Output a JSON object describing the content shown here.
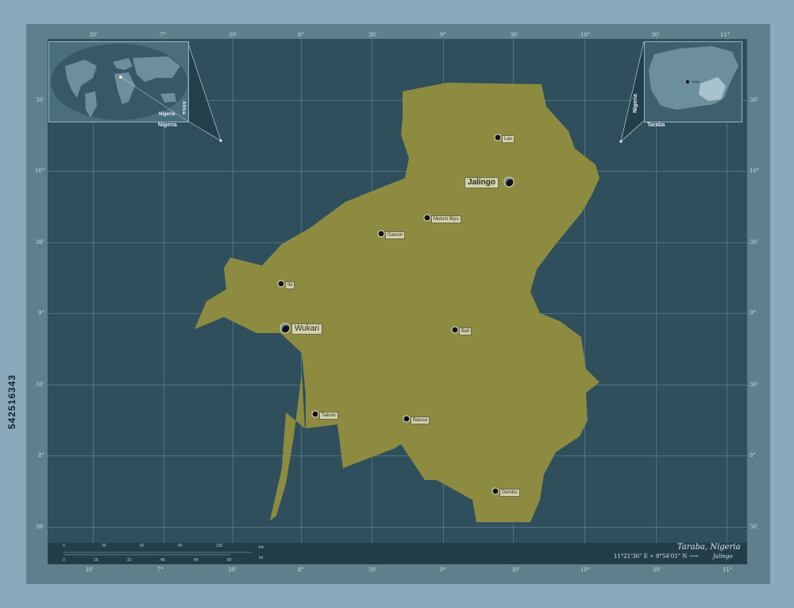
{
  "region_name": "Taraba",
  "country_name": "Nigeria",
  "continent_label": "Africa",
  "capital_inset_label": "Abuja",
  "title": "Taraba, Nigeria",
  "coordinates": "11°21'36\" E  ✧  8°54'01\" N",
  "capital_arrow": "⟶",
  "capital_name": "Jalingo",
  "watermark_id": "542516343",
  "top_ticks": [
    "30'",
    "7°",
    "30'",
    "8°",
    "30'",
    "9°",
    "30'",
    "10°",
    "30'",
    "11°"
  ],
  "bottom_ticks": [
    "30'",
    "7°",
    "30'",
    "8°",
    "30'",
    "9°",
    "30'",
    "10°",
    "30'",
    "11°"
  ],
  "left_ticks": [
    "30'",
    "10°",
    "30'",
    "9°",
    "30'",
    "8°",
    "30'"
  ],
  "right_ticks": [
    "30'",
    "10°",
    "30'",
    "9°",
    "30'",
    "8°",
    "30'"
  ],
  "scale": {
    "km_label": "km",
    "mi_label": "mi",
    "km_values": [
      "0",
      "30",
      "60",
      "90",
      "120"
    ],
    "mi_values": [
      "0",
      "16",
      "32",
      "48",
      "64",
      "80"
    ]
  },
  "cities": [
    {
      "name": "Jalingo",
      "major": true
    },
    {
      "name": "Wukari",
      "major": true
    },
    {
      "name": "Lau",
      "major": false
    },
    {
      "name": "Mutum Biyu",
      "major": false
    },
    {
      "name": "Gassol",
      "major": false
    },
    {
      "name": "Ibi",
      "major": false
    },
    {
      "name": "Bali",
      "major": false
    },
    {
      "name": "Takum",
      "major": false
    },
    {
      "name": "Baissa",
      "major": false
    },
    {
      "name": "Gembu",
      "major": false
    }
  ],
  "colors": {
    "region_fill": "#8c8b40",
    "map_bg": "#2f4f5d",
    "frame": "#5f7f8c",
    "page_bg": "#8aa9bb"
  }
}
